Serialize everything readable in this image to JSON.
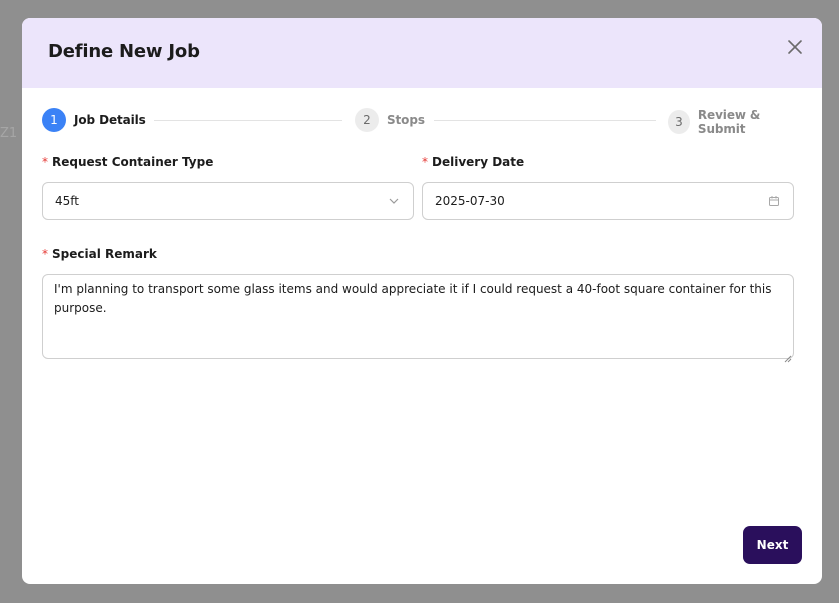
{
  "background": {
    "partial_text": "Z1"
  },
  "modal": {
    "title": "Define New Job",
    "close_icon": "close-icon"
  },
  "steps": [
    {
      "number": "1",
      "label": "Job Details",
      "state": "active"
    },
    {
      "number": "2",
      "label": "Stops",
      "state": "inactive"
    },
    {
      "number": "3",
      "label": "Review & Submit",
      "state": "inactive"
    }
  ],
  "form": {
    "container_type": {
      "label": "Request Container Type",
      "required_mark": "*",
      "value": "45ft",
      "icon": "chevron-down-icon"
    },
    "delivery_date": {
      "label": "Delivery Date",
      "required_mark": "*",
      "value": "2025-07-30",
      "icon": "calendar-icon"
    },
    "special_remark": {
      "label": "Special Remark",
      "required_mark": "*",
      "value": "I'm planning to transport some glass items and would appreciate it if I could request a 40-foot square container for this purpose."
    }
  },
  "footer": {
    "next_label": "Next"
  },
  "colors": {
    "overlay": "#8f8f8f",
    "header_bg": "#ece5fb",
    "active_step": "#3b82f6",
    "primary_button": "#2a0f5c",
    "required": "#e53935"
  }
}
